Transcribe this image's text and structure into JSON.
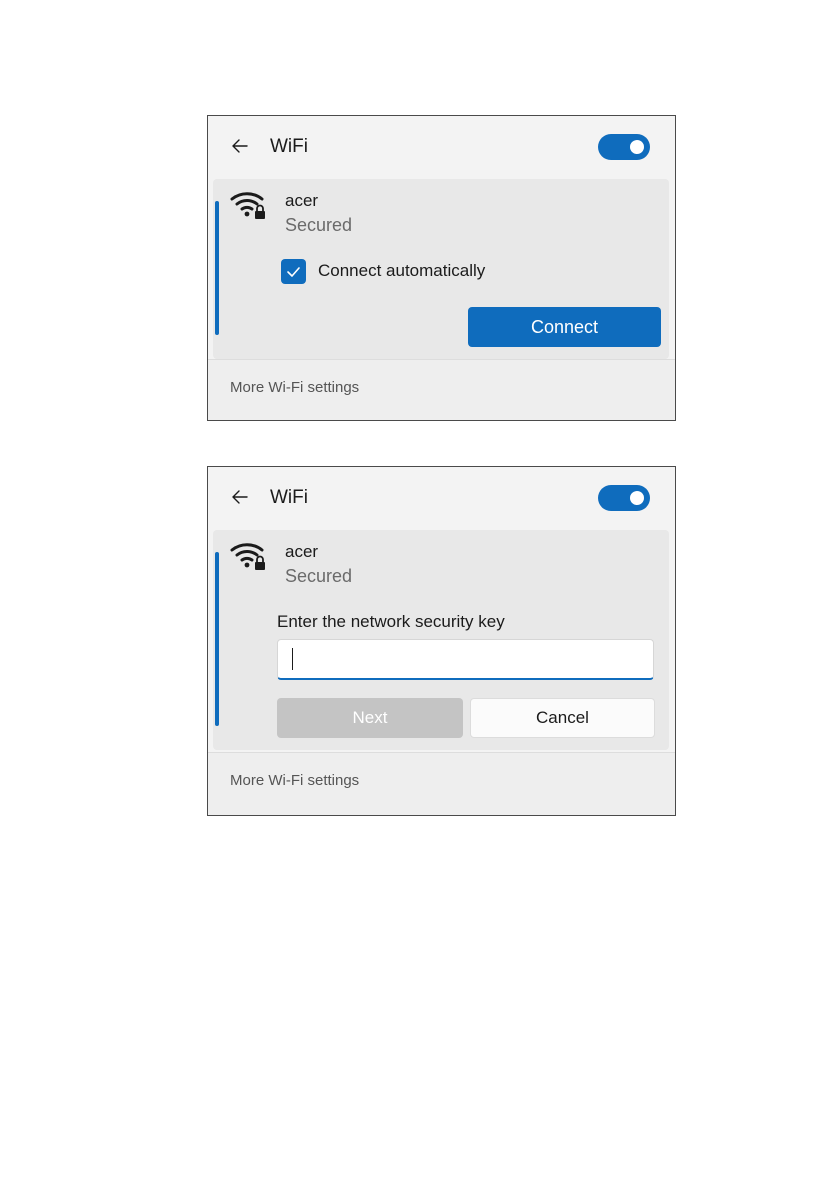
{
  "panels": [
    {
      "header": {
        "title": "WiFi",
        "toggle_on": true
      },
      "network": {
        "name": "acer",
        "status": "Secured"
      },
      "auto_connect": {
        "label": "Connect automatically",
        "checked": true
      },
      "connect_button": "Connect",
      "footer_link": "More Wi-Fi settings"
    },
    {
      "header": {
        "title": "WiFi",
        "toggle_on": true
      },
      "network": {
        "name": "acer",
        "status": "Secured"
      },
      "security_key": {
        "label": "Enter the network security key",
        "value": ""
      },
      "next_button": "Next",
      "cancel_button": "Cancel",
      "footer_link": "More Wi-Fi settings"
    }
  ],
  "icons": {
    "back": "arrow-left-icon",
    "wifi": "wifi-secured-icon",
    "check": "checkmark-icon"
  },
  "colors": {
    "accent": "#0f6cbd",
    "panel_bg": "#f3f3f3",
    "card_bg": "#e8e8e8",
    "disabled_button": "#c4c4c4"
  }
}
